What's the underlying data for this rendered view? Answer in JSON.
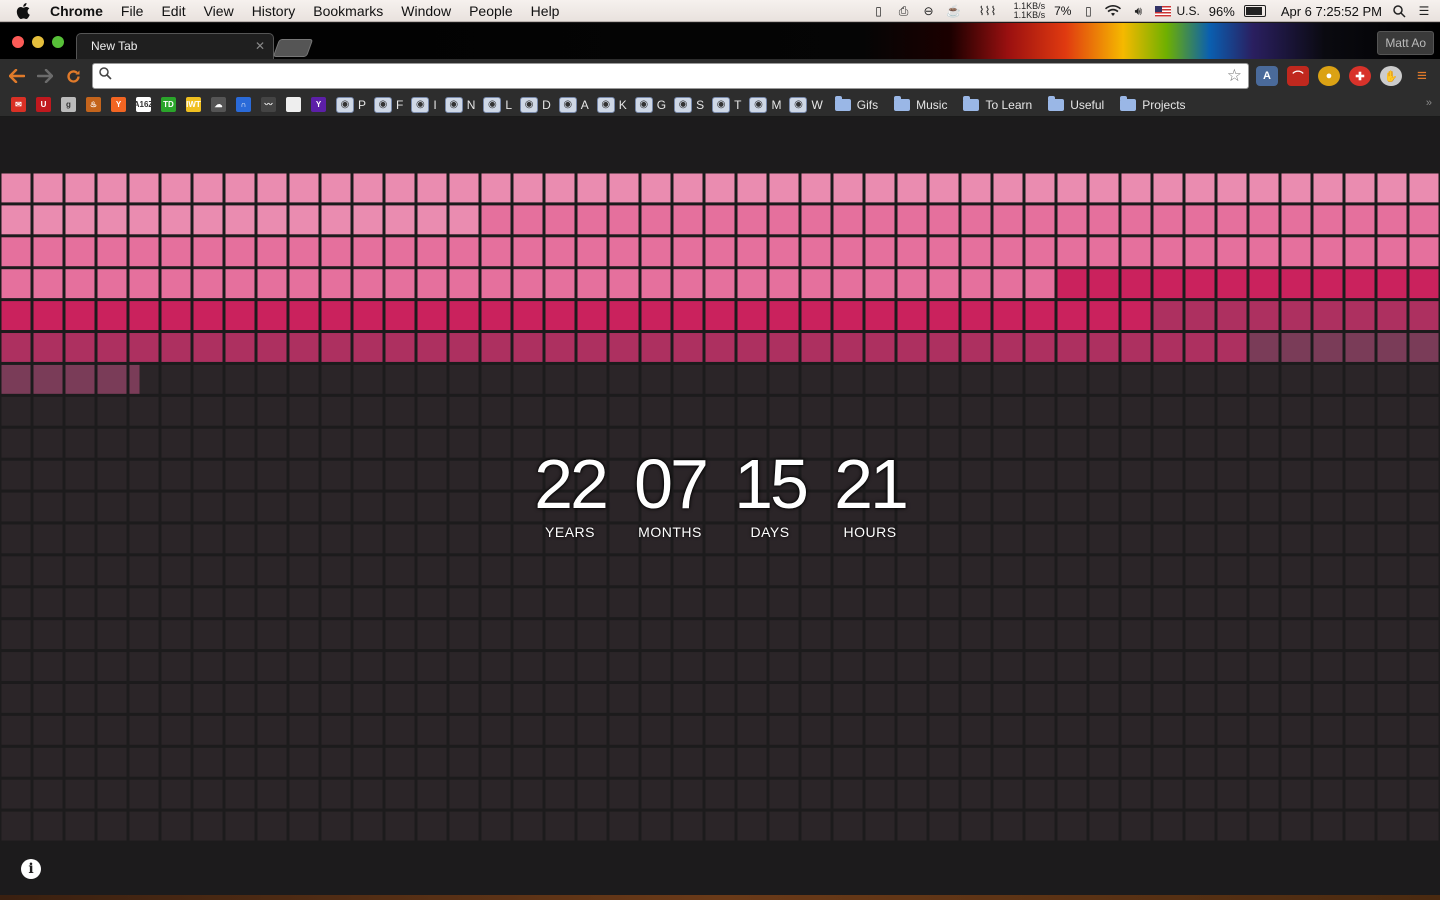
{
  "menubar": {
    "app_name": "Chrome",
    "items": [
      "File",
      "Edit",
      "View",
      "History",
      "Bookmarks",
      "Window",
      "People",
      "Help"
    ],
    "status": {
      "net_up": "1.1KB/s",
      "net_down": "1.1KB/s",
      "cpu": "7%",
      "input_source": "U.S.",
      "battery": "96%",
      "battery_level": 0.96,
      "clock": "Apr 6  7:25:52 PM"
    }
  },
  "browser": {
    "tab_title": "New Tab",
    "profile_name": "Matt Ao",
    "omnibox_value": "",
    "extension_colors": [
      "#4a6a9a",
      "#c0281e",
      "#dba214",
      "#d8322a",
      "#cccccc",
      "#e07a2a"
    ]
  },
  "bookmarks": [
    {
      "label": "",
      "icon": "gmail-icon",
      "color": "#d93025",
      "glyph": "✉"
    },
    {
      "label": "",
      "icon": "u-icon",
      "color": "#c0181e",
      "glyph": "U"
    },
    {
      "label": "",
      "icon": "g-icon",
      "color": "#bbbbbb",
      "glyph": "g"
    },
    {
      "label": "",
      "icon": "fire-icon",
      "color": "#c4641c",
      "glyph": "♨"
    },
    {
      "label": "",
      "icon": "ycombinator-icon",
      "color": "#f26522",
      "glyph": "Y"
    },
    {
      "label": "",
      "icon": "a16z-icon",
      "color": "#ffffff",
      "glyph": "A16Z"
    },
    {
      "label": "",
      "icon": "td-icon",
      "color": "#2aa52a",
      "glyph": "TD"
    },
    {
      "label": "",
      "icon": "iwt-icon",
      "color": "#f0c020",
      "glyph": "IWT"
    },
    {
      "label": "",
      "icon": "cloud-icon",
      "color": "#555555",
      "glyph": "☁"
    },
    {
      "label": "",
      "icon": "magnet-icon",
      "color": "#2a6ad8",
      "glyph": "∩"
    },
    {
      "label": "",
      "icon": "mustache-icon",
      "color": "#444444",
      "glyph": "〰"
    },
    {
      "label": "",
      "icon": "page-icon",
      "color": "#eeeeee",
      "glyph": ""
    },
    {
      "label": "",
      "icon": "yahoo-icon",
      "color": "#5c1fa8",
      "glyph": "Y"
    },
    {
      "label": "P",
      "icon": "reddit-icon"
    },
    {
      "label": "F",
      "icon": "reddit-icon"
    },
    {
      "label": "I",
      "icon": "reddit-icon"
    },
    {
      "label": "N",
      "icon": "reddit-icon"
    },
    {
      "label": "L",
      "icon": "reddit-icon"
    },
    {
      "label": "D",
      "icon": "reddit-icon"
    },
    {
      "label": "A",
      "icon": "reddit-icon"
    },
    {
      "label": "K",
      "icon": "reddit-icon"
    },
    {
      "label": "G",
      "icon": "reddit-icon"
    },
    {
      "label": "S",
      "icon": "reddit-icon"
    },
    {
      "label": "T",
      "icon": "reddit-icon"
    },
    {
      "label": "M",
      "icon": "reddit-icon"
    },
    {
      "label": "W",
      "icon": "reddit-icon"
    }
  ],
  "bookmark_folders": [
    "Gifs",
    "Music",
    "To Learn",
    "Useful",
    "Projects"
  ],
  "life_grid": {
    "columns": 45,
    "rows": 21,
    "row_colors": [
      [
        "#ea8cb0",
        45
      ],
      [
        "#ea8cb0",
        15,
        "#e5709d",
        30
      ],
      [
        "#e5709d",
        45
      ],
      [
        "#e5709d",
        33,
        "#ca225d",
        12
      ],
      [
        "#ca225d",
        36,
        "#ad3060",
        9
      ],
      [
        "#ad3060",
        39,
        "#7a3c58",
        6
      ],
      [
        "#7a3c58",
        4,
        "partial",
        1
      ]
    ],
    "filled_color_empty": "#2b2528",
    "border_color": "#1c1b1c"
  },
  "counter": {
    "years": {
      "value": "22",
      "label": "YEARS"
    },
    "months": {
      "value": "07",
      "label": "MONTHS"
    },
    "days": {
      "value": "15",
      "label": "DAYS"
    },
    "hours": {
      "value": "21",
      "label": "HOURS"
    }
  },
  "info_glyph": "i"
}
